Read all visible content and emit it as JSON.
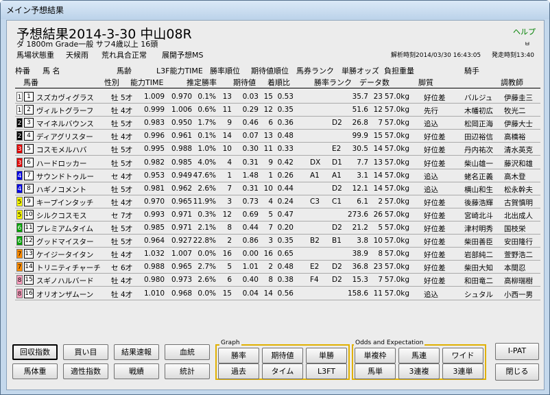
{
  "window": {
    "title": "メイン予想結果"
  },
  "header": {
    "title": "予想結果2014-3-30 中山08R",
    "line2": "ダ 1800m Grade一般 サフ4歳以上 16頭",
    "line3": [
      "馬場状態重",
      "天候雨",
      "荒れ具合正常",
      "展開予想MS"
    ],
    "analysis_time": "解析時刻2014/03/30 16:43:05",
    "post_time": "発走時刻13:40",
    "help": "ヘルプ",
    "min_icon": "ㅂ"
  },
  "columns_row1": [
    "枠番",
    "馬 名",
    "馬齢",
    "L3F能力TIME",
    "勝率順位",
    "期待値順位",
    "馬券ランク",
    "単勝オッズ",
    "負担重量",
    "騎手"
  ],
  "columns_row2": [
    "馬番",
    "性別",
    "能力TIME",
    "推定勝率",
    "期待値",
    "着順比",
    "勝率ランク",
    "データ数",
    "脚質",
    "調教師"
  ],
  "rows": [
    {
      "waku": "1",
      "ban": "1",
      "name": "スズカヴィグラス",
      "sex": "牡",
      "age": "5才",
      "t1": "1.009",
      "t2": "0.970",
      "rate": "0.1%",
      "rk": "13",
      "exp": "0.03",
      "exprk": "15",
      "ratio": "0.53",
      "b1": "",
      "b2": "",
      "odds": "35.7",
      "data": "23",
      "wt": "57.0kg",
      "style": "好位差",
      "jockey": "バルジュ",
      "trainer": "伊藤圭三"
    },
    {
      "waku": "1",
      "ban": "2",
      "name": "ヴィルトグラーフ",
      "sex": "牡",
      "age": "4才",
      "t1": "0.999",
      "t2": "1.006",
      "rate": "0.6%",
      "rk": "11",
      "exp": "0.29",
      "exprk": "12",
      "ratio": "0.35",
      "b1": "",
      "b2": "",
      "odds": "51.6",
      "data": "12",
      "wt": "57.0kg",
      "style": "先行",
      "jockey": "木幡初広",
      "trainer": "牧光二"
    },
    {
      "waku": "2",
      "ban": "3",
      "name": "マイネルバウンス",
      "sex": "牡",
      "age": "5才",
      "t1": "0.983",
      "t2": "0.950",
      "rate": "1.7%",
      "rk": "9",
      "exp": "0.46",
      "exprk": "6",
      "ratio": "0.36",
      "b1": "",
      "b2": "D2",
      "odds": "26.8",
      "data": "7",
      "wt": "57.0kg",
      "style": "追込",
      "jockey": "松岡正海",
      "trainer": "伊藤大士"
    },
    {
      "waku": "2",
      "ban": "4",
      "name": "ディアグリスター",
      "sex": "牡",
      "age": "4才",
      "t1": "0.996",
      "t2": "0.961",
      "rate": "0.1%",
      "rk": "14",
      "exp": "0.07",
      "exprk": "13",
      "ratio": "0.48",
      "b1": "",
      "b2": "",
      "odds": "99.9",
      "data": "15",
      "wt": "57.0kg",
      "style": "好位差",
      "jockey": "田辺裕信",
      "trainer": "高橋裕"
    },
    {
      "waku": "3",
      "ban": "5",
      "name": "コスモメルハバ",
      "sex": "牡",
      "age": "5才",
      "t1": "0.995",
      "t2": "0.988",
      "rate": "1.0%",
      "rk": "10",
      "exp": "0.30",
      "exprk": "11",
      "ratio": "0.33",
      "b1": "",
      "b2": "E2",
      "odds": "30.5",
      "data": "14",
      "wt": "57.0kg",
      "style": "好位差",
      "jockey": "丹内祐次",
      "trainer": "清水英克"
    },
    {
      "waku": "3",
      "ban": "6",
      "name": "ハードロッカー",
      "sex": "牡",
      "age": "5才",
      "t1": "0.982",
      "t2": "0.985",
      "rate": "4.0%",
      "rk": "4",
      "exp": "0.31",
      "exprk": "9",
      "ratio": "0.42",
      "b1": "DX",
      "b2": "D1",
      "odds": "7.7",
      "data": "13",
      "wt": "57.0kg",
      "style": "好位差",
      "jockey": "柴山雄一",
      "trainer": "藤沢和雄"
    },
    {
      "waku": "4",
      "ban": "7",
      "name": "サウンドトゥルー",
      "sex": "セ",
      "age": "4才",
      "t1": "0.953",
      "t2": "0.949",
      "rate": "47.6%",
      "rk": "1",
      "exp": "1.48",
      "exprk": "1",
      "ratio": "0.26",
      "b1": "A1",
      "b2": "A1",
      "odds": "3.1",
      "data": "14",
      "wt": "57.0kg",
      "style": "追込",
      "jockey": "蛯名正義",
      "trainer": "高木登"
    },
    {
      "waku": "4",
      "ban": "8",
      "name": "ハギノコメント",
      "sex": "牡",
      "age": "5才",
      "t1": "0.981",
      "t2": "0.962",
      "rate": "2.6%",
      "rk": "7",
      "exp": "0.31",
      "exprk": "10",
      "ratio": "0.44",
      "b1": "",
      "b2": "D2",
      "odds": "12.1",
      "data": "14",
      "wt": "57.0kg",
      "style": "追込",
      "jockey": "横山和生",
      "trainer": "松永幹夫"
    },
    {
      "waku": "5",
      "ban": "9",
      "name": "キープインタッチ",
      "sex": "牡",
      "age": "4才",
      "t1": "0.970",
      "t2": "0.965",
      "rate": "11.9%",
      "rk": "3",
      "exp": "0.73",
      "exprk": "4",
      "ratio": "0.24",
      "b1": "C3",
      "b2": "C1",
      "odds": "6.1",
      "data": "2",
      "wt": "57.0kg",
      "style": "好位差",
      "jockey": "後藤浩輝",
      "trainer": "古賀慎明"
    },
    {
      "waku": "5",
      "ban": "10",
      "name": "シルクコスモス",
      "sex": "セ",
      "age": "7才",
      "t1": "0.993",
      "t2": "0.971",
      "rate": "0.3%",
      "rk": "12",
      "exp": "0.69",
      "exprk": "5",
      "ratio": "0.47",
      "b1": "",
      "b2": "",
      "odds": "273.6",
      "data": "26",
      "wt": "57.0kg",
      "style": "好位差",
      "jockey": "宮崎北斗",
      "trainer": "北出成人"
    },
    {
      "waku": "6",
      "ban": "11",
      "name": "プレミアムタイム",
      "sex": "牡",
      "age": "5才",
      "t1": "0.985",
      "t2": "0.971",
      "rate": "2.1%",
      "rk": "8",
      "exp": "0.44",
      "exprk": "7",
      "ratio": "0.20",
      "b1": "",
      "b2": "D2",
      "odds": "21.2",
      "data": "5",
      "wt": "57.0kg",
      "style": "好位差",
      "jockey": "津村明秀",
      "trainer": "国枝栄"
    },
    {
      "waku": "6",
      "ban": "12",
      "name": "グッドマイスター",
      "sex": "牡",
      "age": "5才",
      "t1": "0.964",
      "t2": "0.927",
      "rate": "22.8%",
      "rk": "2",
      "exp": "0.86",
      "exprk": "3",
      "ratio": "0.35",
      "b1": "B2",
      "b2": "B1",
      "odds": "3.8",
      "data": "10",
      "wt": "57.0kg",
      "style": "好位差",
      "jockey": "柴田善臣",
      "trainer": "安田隆行"
    },
    {
      "waku": "7",
      "ban": "13",
      "name": "ケイジータイタン",
      "sex": "牡",
      "age": "4才",
      "t1": "1.032",
      "t2": "1.007",
      "rate": "0.0%",
      "rk": "16",
      "exp": "0.00",
      "exprk": "16",
      "ratio": "0.65",
      "b1": "",
      "b2": "",
      "odds": "38.9",
      "data": "8",
      "wt": "57.0kg",
      "style": "好位差",
      "jockey": "岩部純二",
      "trainer": "萱野浩二"
    },
    {
      "waku": "7",
      "ban": "14",
      "name": "トリニティチャーチ",
      "sex": "セ",
      "age": "6才",
      "t1": "0.988",
      "t2": "0.965",
      "rate": "2.7%",
      "rk": "5",
      "exp": "1.01",
      "exprk": "2",
      "ratio": "0.48",
      "b1": "E2",
      "b2": "D2",
      "odds": "36.8",
      "data": "23",
      "wt": "57.0kg",
      "style": "好位差",
      "jockey": "柴田大知",
      "trainer": "本間忍"
    },
    {
      "waku": "8",
      "ban": "15",
      "name": "スギノハルバード",
      "sex": "牡",
      "age": "4才",
      "t1": "0.980",
      "t2": "0.973",
      "rate": "2.6%",
      "rk": "6",
      "exp": "0.40",
      "exprk": "8",
      "ratio": "0.38",
      "b1": "F4",
      "b2": "D2",
      "odds": "15.3",
      "data": "7",
      "wt": "57.0kg",
      "style": "好位差",
      "jockey": "和田竜二",
      "trainer": "高柳瑞樹"
    },
    {
      "waku": "8",
      "ban": "16",
      "name": "オリオンザムーン",
      "sex": "牡",
      "age": "4才",
      "t1": "1.010",
      "t2": "0.968",
      "rate": "0.0%",
      "rk": "15",
      "exp": "0.04",
      "exprk": "14",
      "ratio": "0.56",
      "b1": "",
      "b2": "",
      "odds": "158.6",
      "data": "11",
      "wt": "57.0kg",
      "style": "追込",
      "jockey": "シュタル",
      "trainer": "小西一男"
    }
  ],
  "waku_colors": {
    "1": "#ffffff",
    "2": "#000000",
    "3": "#e00000",
    "4": "#0000e0",
    "5": "#ffff00",
    "6": "#00a000",
    "7": "#ff8c00",
    "8": "#ffa0c0"
  },
  "buttons_left": [
    "回収指数",
    "買い目",
    "結果速報",
    "血統",
    "馬体重",
    "適性指数",
    "戦績",
    "統計"
  ],
  "graph": {
    "label": "Graph",
    "buttons": [
      "勝率",
      "期待値",
      "単勝",
      "過去",
      "タイム",
      "L3FT"
    ]
  },
  "odds": {
    "label": "Odds and Expectation",
    "buttons": [
      "単複枠",
      "馬連",
      "ワイド",
      "馬単",
      "3連複",
      "3連単"
    ]
  },
  "buttons_right": [
    "I-PAT",
    "閉じる"
  ]
}
